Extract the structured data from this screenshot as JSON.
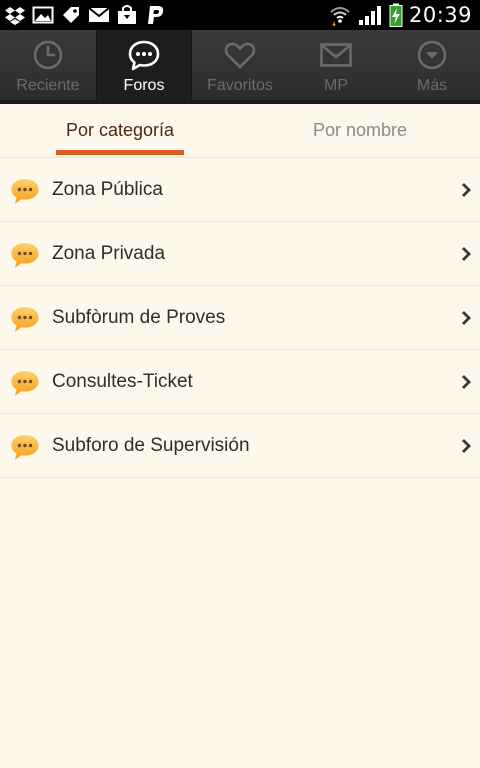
{
  "status_bar": {
    "time": "20:39",
    "left_icons": [
      "dropbox-icon",
      "image-icon",
      "tag-icon",
      "mail-icon",
      "shopping-bag-icon",
      "paypal-icon"
    ],
    "right_icons": [
      "wifi-icon",
      "signal-icon",
      "battery-charging-icon"
    ]
  },
  "tabs": [
    {
      "label": "Reciente",
      "icon": "clock-icon",
      "active": false
    },
    {
      "label": "Foros",
      "icon": "chat-bubble-icon",
      "active": true
    },
    {
      "label": "Favoritos",
      "icon": "heart-icon",
      "active": false
    },
    {
      "label": "MP",
      "icon": "envelope-icon",
      "active": false
    },
    {
      "label": "Más",
      "icon": "chevron-circle-icon",
      "active": false
    }
  ],
  "subtabs": [
    {
      "label": "Por categoría",
      "active": true
    },
    {
      "label": "Por nombre",
      "active": false
    }
  ],
  "forums": [
    {
      "label": "Zona Pública"
    },
    {
      "label": "Zona Privada"
    },
    {
      "label": "Subfòrum de Proves"
    },
    {
      "label": "Consultes-Ticket"
    },
    {
      "label": "Subforo de Supervisión"
    }
  ],
  "colors": {
    "accent": "#d95f1f",
    "background": "#fdf7ec",
    "tab_bar": "#2f2f2f",
    "bubble": "#f4b73a"
  }
}
